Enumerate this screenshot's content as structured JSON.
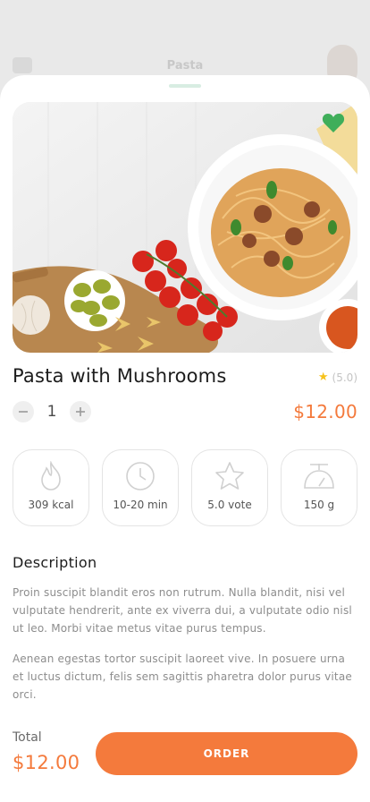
{
  "background": {
    "title": "Pasta"
  },
  "product": {
    "title": "Pasta with Mushrooms",
    "rating": "(5.0)",
    "quantity": "1",
    "price": "$12.00",
    "favorite": true
  },
  "stats": [
    {
      "icon": "flame-icon",
      "value": "309 kcal"
    },
    {
      "icon": "clock-icon",
      "value": "10-20 min"
    },
    {
      "icon": "star-icon",
      "value": "5.0 vote"
    },
    {
      "icon": "scale-icon",
      "value": "150 g"
    }
  ],
  "description": {
    "heading": "Description",
    "paragraphs": [
      "Proin suscipit blandit eros non rutrum. Nulla blandit, nisi vel vulputate hendrerit, ante ex viverra dui, a vulputate odio nisl ut leo. Morbi vitae metus vitae purus tempus.",
      "Aenean egestas tortor suscipit laoreet vive. In posuere urna et luctus dictum, felis sem sagittis pharetra dolor purus vitae orci."
    ]
  },
  "footer": {
    "total_label": "Total",
    "total_value": "$12.00",
    "order_label": "ORDER"
  },
  "colors": {
    "accent": "#f47a3c",
    "favorite": "#3fae5a",
    "star": "#f6c21b"
  }
}
